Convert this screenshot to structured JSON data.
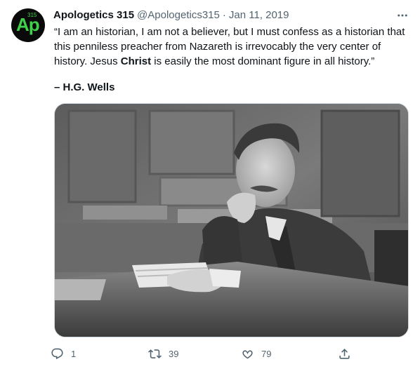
{
  "account": {
    "display_name": "Apologetics 315",
    "handle": "@Apologetics315",
    "separator": "·",
    "date": "Jan 11, 2019",
    "avatar_text": "Ap",
    "avatar_number": "315"
  },
  "tweet": {
    "quote_part1": "“I am an historian, I am not a believer, but I must confess as a historian that this penniless preacher from Nazareth is irrevocably the very center of history. Jesus ",
    "quote_bold": "Christ",
    "quote_part2": " is easily the most dominant figure in all history.”",
    "attribution": "– H.G. Wells"
  },
  "media": {
    "description_icon": "photo-image"
  },
  "actions": {
    "reply_count": "1",
    "retweet_count": "39",
    "like_count": "79"
  },
  "icons": {
    "more": "more-horizontal-icon",
    "reply": "reply-icon",
    "retweet": "retweet-icon",
    "like": "heart-icon",
    "share": "share-icon"
  },
  "colors": {
    "text": "#0f1419",
    "secondary": "#536471",
    "avatar_bg": "#0a0a0a",
    "avatar_fg": "#3fd14a"
  }
}
